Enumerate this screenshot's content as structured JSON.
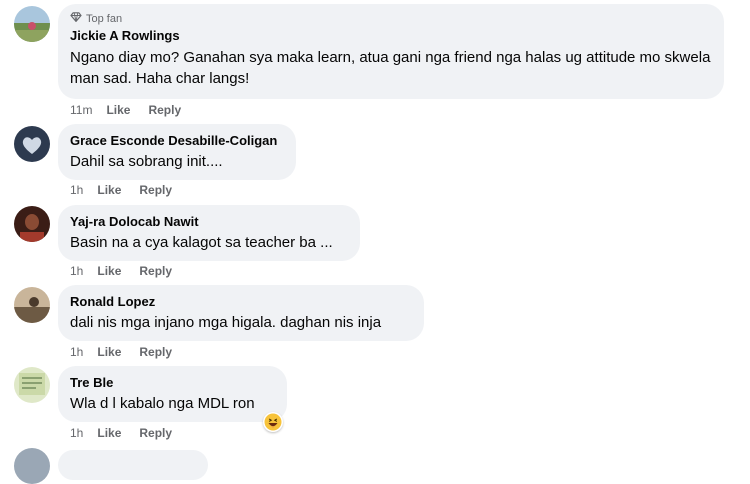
{
  "comments": [
    {
      "badge": "Top fan",
      "author": "Jickie A Rowlings",
      "text": "Ngano diay mo? Ganahan sya maka learn, atua gani nga friend nga halas ug attitude mo skwela man sad. Haha char langs!",
      "time": "11m",
      "like": "Like",
      "reply": "Reply"
    },
    {
      "author": "Grace Esconde Desabille-Coligan",
      "text": "Dahil sa sobrang init....",
      "time": "1h",
      "like": "Like",
      "reply": "Reply"
    },
    {
      "author": "Yaj-ra Dolocab Nawit",
      "text": "Basin na a cya kalagot sa teacher ba ...",
      "time": "1h",
      "like": "Like",
      "reply": "Reply"
    },
    {
      "author": "Ronald Lopez",
      "text": "dali nis mga injano mga higala. daghan nis inja",
      "time": "1h",
      "like": "Like",
      "reply": "Reply"
    },
    {
      "author": "Tre Ble",
      "text": "Wla d l kabalo nga MDL ron",
      "time": "1h",
      "like": "Like",
      "reply": "Reply",
      "reaction": "haha-emoji-icon"
    }
  ],
  "colors": {
    "bubble": "#f0f2f5",
    "meta": "#65676b",
    "text": "#050505"
  }
}
